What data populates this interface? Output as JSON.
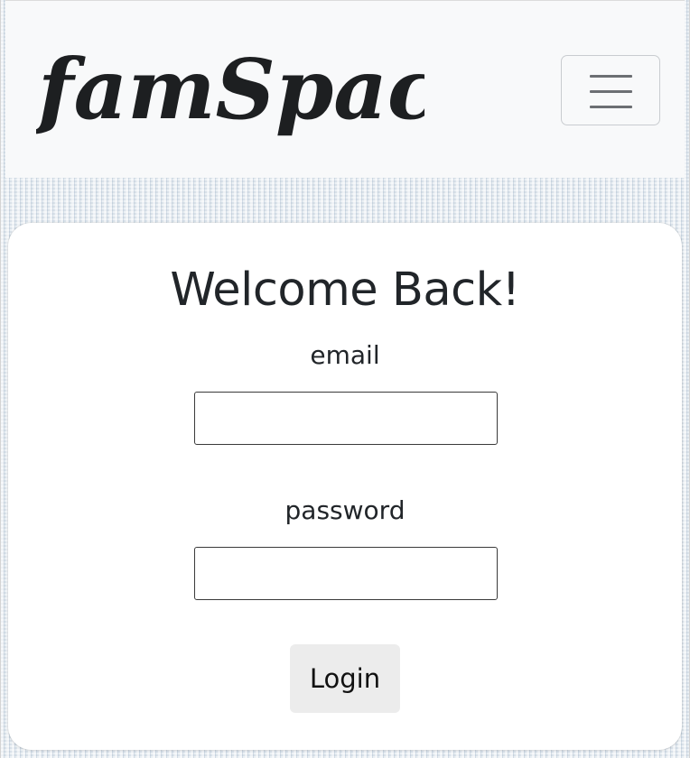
{
  "navbar": {
    "brand": "famSpace",
    "menu_icon": "hamburger-menu-icon"
  },
  "login_card": {
    "title": "Welcome Back!",
    "email_label": "email",
    "email_value": "",
    "password_label": "password",
    "password_value": "",
    "login_button": "Login"
  },
  "colors": {
    "navbar_bg": "#f8f9fa",
    "card_bg": "#ffffff",
    "text": "#212529",
    "button_bg": "#ececec"
  }
}
